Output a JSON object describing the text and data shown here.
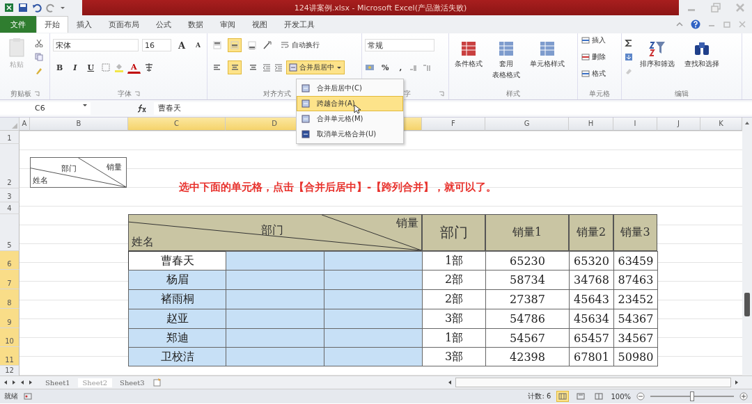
{
  "title_bar": {
    "title": "124讲案例.xlsx - Microsoft Excel(产品激活失败)"
  },
  "file_button": "文件",
  "ribbon_tabs": [
    {
      "label": "开始",
      "selected": true
    },
    {
      "label": "插入",
      "selected": false
    },
    {
      "label": "页面布局",
      "selected": false
    },
    {
      "label": "公式",
      "selected": false
    },
    {
      "label": "数据",
      "selected": false
    },
    {
      "label": "审阅",
      "selected": false
    },
    {
      "label": "视图",
      "selected": false
    },
    {
      "label": "开发工具",
      "selected": false
    }
  ],
  "clipboard": {
    "paste": "粘贴",
    "group": "剪贴板"
  },
  "font": {
    "name": "宋体",
    "size": "16",
    "grow": "A",
    "shrink": "A",
    "bold": "B",
    "italic": "I",
    "underline": "U",
    "color_letter": "A",
    "group": "字体"
  },
  "alignment": {
    "vertical": [
      {
        "selected": false
      },
      {
        "selected": true
      },
      {
        "selected": false
      }
    ],
    "horizontal": [
      {
        "selected": false
      },
      {
        "selected": true
      },
      {
        "selected": false
      }
    ],
    "wrap": "自动换行",
    "merge": "合并后居中",
    "merge_selected": true,
    "group": "对齐方式"
  },
  "number": {
    "format": "常规",
    "percent": "%",
    "comma": ",",
    "group": "字"
  },
  "styles": {
    "buttons": [
      {
        "lines": [
          "条件格式"
        ]
      },
      {
        "lines": [
          "套用",
          "表格格式"
        ]
      },
      {
        "lines": [
          "单元格样式"
        ]
      }
    ],
    "group": "样式"
  },
  "cells": {
    "buttons": [
      "插入",
      "删除",
      "格式"
    ],
    "group": "单元格"
  },
  "editing": {
    "buttons": [
      "排序和筛选",
      "查找和选择"
    ],
    "group": "编辑"
  },
  "merge_menu": [
    {
      "label": "合并后居中(C)",
      "selected": false
    },
    {
      "label": "跨越合并(A)",
      "selected": true
    },
    {
      "label": "合并单元格(M)",
      "selected": false
    },
    {
      "label": "取消单元格合并(U)",
      "selected": false
    }
  ],
  "formula_bar": {
    "name_box": "C6",
    "value": "曹春天"
  },
  "columns": [
    {
      "label": "A",
      "selected": false
    },
    {
      "label": "B",
      "selected": false
    },
    {
      "label": "C",
      "selected": true
    },
    {
      "label": "D",
      "selected": true
    },
    {
      "selected": true
    },
    {
      "label": "F",
      "selected": false
    },
    {
      "label": "G",
      "selected": false
    },
    {
      "label": "H",
      "selected": false
    },
    {
      "label": "I",
      "selected": false
    },
    {
      "label": "J",
      "selected": false
    },
    {
      "label": "K",
      "selected": false
    }
  ],
  "row_numbers": [
    {
      "label": "1",
      "selected": false
    },
    {
      "label": "2",
      "selected": false
    },
    {
      "label": "3",
      "selected": false
    },
    {
      "label": "4",
      "selected": false
    },
    {
      "label": "5",
      "selected": false
    },
    {
      "label": "6",
      "selected": true
    },
    {
      "label": "7",
      "selected": true
    },
    {
      "label": "8",
      "selected": true
    },
    {
      "label": "9",
      "selected": true
    },
    {
      "label": "10",
      "selected": true
    },
    {
      "label": "11",
      "selected": true
    },
    {
      "label": "12",
      "selected": false
    }
  ],
  "sample_header": {
    "top_right": "销量",
    "middle": "部门",
    "bottom_left": "姓名"
  },
  "instruction": "选中下面的单元格，点击【合并后居中】-【跨列合并】，就可以了。",
  "table": {
    "diagonal": {
      "top_right": "销量",
      "middle": "部门",
      "bottom_left": "姓名"
    },
    "columns": [
      "部门",
      "销量1",
      "销量2",
      "销量3"
    ],
    "rows": [
      {
        "name": "曹春天",
        "active": true,
        "selected": true,
        "dept": "1部",
        "values": [
          "65230",
          "65320",
          "63459"
        ]
      },
      {
        "name": "杨眉",
        "active": false,
        "selected": true,
        "dept": "2部",
        "values": [
          "58734",
          "34768",
          "87463"
        ]
      },
      {
        "name": "褚雨桐",
        "active": false,
        "selected": true,
        "dept": "2部",
        "values": [
          "27387",
          "45643",
          "23452"
        ]
      },
      {
        "name": "赵亚",
        "active": false,
        "selected": true,
        "dept": "3部",
        "values": [
          "54786",
          "45634",
          "54367"
        ]
      },
      {
        "name": "郑迪",
        "active": false,
        "selected": true,
        "dept": "1部",
        "values": [
          "54567",
          "65457",
          "34567"
        ]
      },
      {
        "name": "卫校洁",
        "active": false,
        "selected": true,
        "dept": "3部",
        "values": [
          "42398",
          "67801",
          "50980"
        ]
      }
    ]
  },
  "sheet_tabs": [
    {
      "label": "Sheet1",
      "selected": false
    },
    {
      "label": "Sheet2",
      "selected": true
    },
    {
      "label": "Sheet3",
      "selected": false
    }
  ],
  "status_bar": {
    "mode": "就绪",
    "count": "计数: 6",
    "views": [
      {
        "selected": true
      },
      {
        "selected": false
      },
      {
        "selected": false
      }
    ],
    "zoom": "100%",
    "zoom_slider": {
      "level": 0.5
    }
  }
}
